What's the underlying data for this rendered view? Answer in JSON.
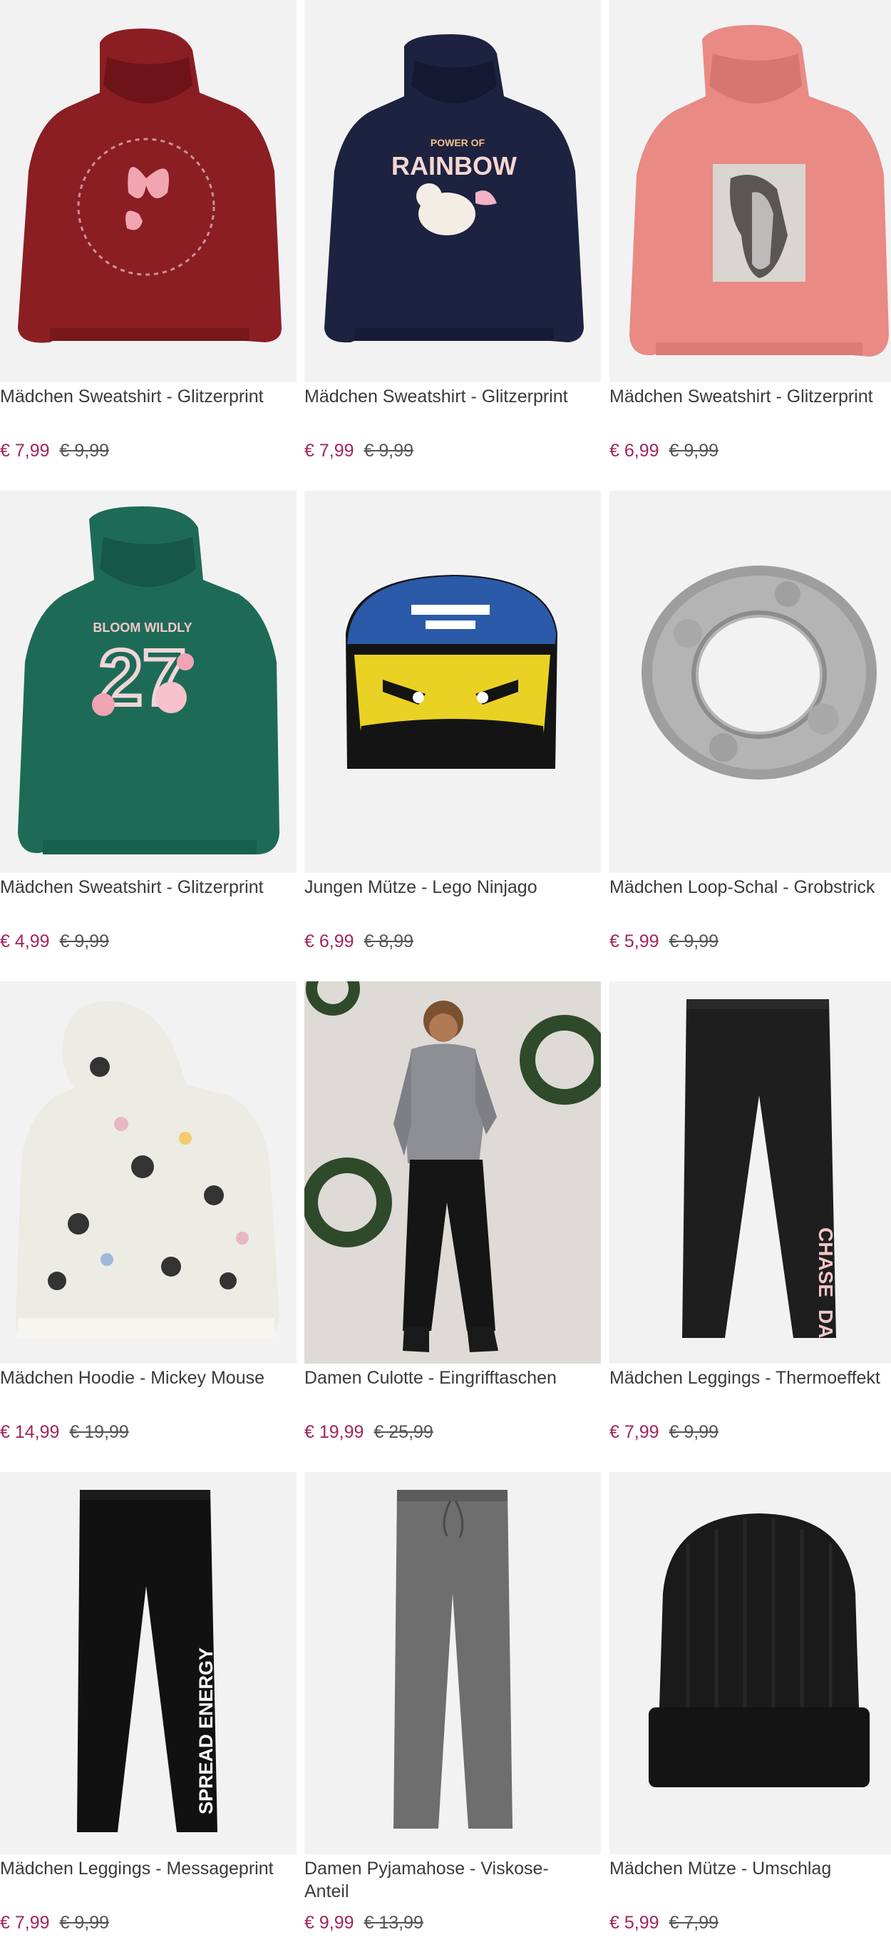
{
  "colors": {
    "price": "#a3245c",
    "old_price": "#555555",
    "image_bg": "#f2f2f2"
  },
  "products": [
    {
      "name": "Mädchen Sweatshirt - Glitzerprint",
      "price": "€ 7,99",
      "old_price": "€ 9,99",
      "image": "red-hoodie-butterflies"
    },
    {
      "name": "Mädchen Sweatshirt - Glitzerprint",
      "price": "€ 7,99",
      "old_price": "€ 9,99",
      "image": "navy-hoodie-unicorn",
      "print_text": [
        "POWER OF",
        "RAINBOW"
      ]
    },
    {
      "name": "Mädchen Sweatshirt - Glitzerprint",
      "price": "€ 6,99",
      "old_price": "€ 9,99",
      "image": "pink-hoodie-horse"
    },
    {
      "name": "Mädchen Sweatshirt - Glitzerprint",
      "price": "€ 4,99",
      "old_price": "€ 9,99",
      "image": "green-hoodie-27",
      "print_text": [
        "BLOOM WILDLY",
        "27"
      ]
    },
    {
      "name": "Jungen Mütze - Lego Ninjago",
      "price": "€ 6,99",
      "old_price": "€ 8,99",
      "image": "ninjago-beanie"
    },
    {
      "name": "Mädchen Loop-Schal - Grobstrick",
      "price": "€ 5,99",
      "old_price": "€ 9,99",
      "image": "grey-loop-scarf"
    },
    {
      "name": "Mädchen Hoodie - Mickey Mouse",
      "price": "€ 14,99",
      "old_price": "€ 19,99",
      "image": "mickey-hoodie"
    },
    {
      "name": "Damen Culotte - Eingrifftaschen",
      "price": "€ 19,99",
      "old_price": "€ 25,99",
      "image": "woman-culotte-photo"
    },
    {
      "name": "Mädchen Leggings - Thermoeffekt",
      "price": "€ 7,99",
      "old_price": "€ 9,99",
      "image": "black-leggings-chase",
      "print_text": [
        "CHASE",
        "DA"
      ]
    },
    {
      "name": "Mädchen Leggings - Messageprint",
      "price": "€ 7,99",
      "old_price": "€ 9,99",
      "image": "black-leggings-spread-energy",
      "print_text": [
        "SPREAD ENERGY"
      ]
    },
    {
      "name": "Damen Pyjamahose - Viskose-Anteil",
      "price": "€ 9,99",
      "old_price": "€ 13,99",
      "image": "grey-pyjama-pants"
    },
    {
      "name": "Mädchen Mütze - Umschlag",
      "price": "€ 5,99",
      "old_price": "€ 7,99",
      "image": "black-beanie"
    }
  ]
}
